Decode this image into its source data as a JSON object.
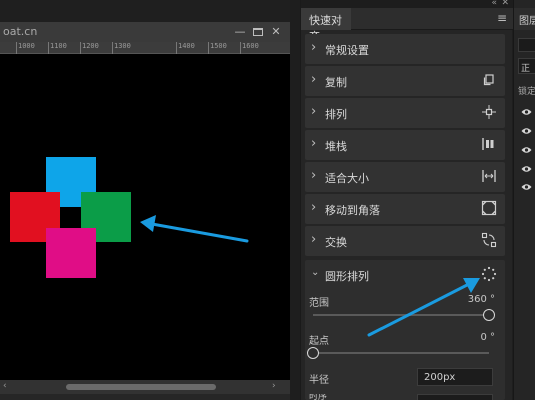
{
  "document": {
    "title": "oat.cn",
    "ruler_ticks": [
      "1000",
      "1100",
      "1200",
      "1300",
      "1400",
      "1500",
      "1600"
    ],
    "shapes": [
      {
        "name": "blue-square",
        "color": "#0ea5e9"
      },
      {
        "name": "red-square",
        "color": "#e11020"
      },
      {
        "name": "green-square",
        "color": "#0b9d48"
      },
      {
        "name": "magenta-square",
        "color": "#e00d86"
      }
    ],
    "window_buttons": {
      "minimize": "—",
      "restore": "▫",
      "close": "✕"
    }
  },
  "panel": {
    "tab_label": "快速对齐",
    "menu_icon": "≡",
    "collapse": "«",
    "close": "✕",
    "sections": [
      {
        "label": "常规设置",
        "icon": null
      },
      {
        "label": "复制",
        "icon": "copy-icon"
      },
      {
        "label": "排列",
        "icon": "arrange-icon"
      },
      {
        "label": "堆栈",
        "icon": "stack-icon"
      },
      {
        "label": "适合大小",
        "icon": "fit-size-icon"
      },
      {
        "label": "移动到角落",
        "icon": "corner-icon"
      },
      {
        "label": "交换",
        "icon": "swap-icon"
      }
    ],
    "circle": {
      "label": "圆形排列",
      "icon": "circle-arrange-icon",
      "range_label": "范围",
      "range_value": "360 °",
      "range_fraction": 1,
      "start_label": "起点",
      "start_value": "0 °",
      "start_fraction": 0,
      "radius_label": "半径",
      "radius_value": "200px",
      "start_row_label": "时序"
    }
  },
  "layers": {
    "tab_label": "图层",
    "field_label": "正",
    "lock_label": "锁定"
  },
  "colors": {
    "annotation_arrow": "#1a9be0"
  }
}
